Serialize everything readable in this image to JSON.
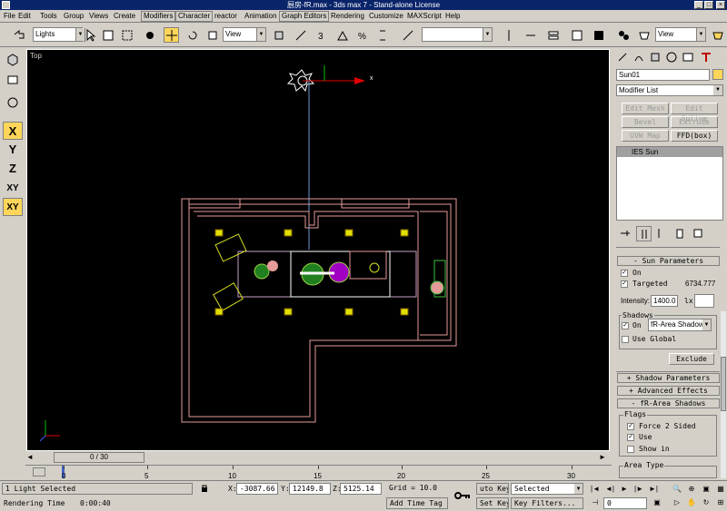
{
  "window": {
    "title": "厨房-fR.max - 3ds max 7 - Stand-alone License"
  },
  "menu": [
    "File",
    "Edit",
    "Tools",
    "Group",
    "Views",
    "Create",
    "Modifiers",
    "Character",
    "reactor",
    "Animation",
    "Graph Editors",
    "Rendering",
    "Customize",
    "MAXScript",
    "Help"
  ],
  "toolbar": {
    "selection_filter": "Lights",
    "ref_coord": "View",
    "named_sel": "",
    "render_view": "View"
  },
  "left_toolbar": {
    "x": "X",
    "y": "Y",
    "z": "Z",
    "xy": "XY",
    "xy2": "XY"
  },
  "viewport": {
    "label": "Top",
    "axis_x": "x"
  },
  "command_panel": {
    "object_name": "Sun01",
    "modifier_list": "Modifier List",
    "mod_buttons": [
      "Edit Mesh",
      "Edit Spline",
      "Bevel",
      "Extrude",
      "UVW Map",
      "FFD(box)"
    ],
    "stack_item": "IES Sun",
    "sun_rollout": "Sun Parameters",
    "on_label": "On",
    "targeted_label": "Targeted",
    "targeted_value": "6734.777",
    "intensity_label": "Intensity:",
    "intensity_value": "1400.0",
    "lx_label": "lx",
    "shadows_label": "Shadows",
    "shadows_on_label": "On",
    "shadow_type": "fR-Area Shadow",
    "use_global": "Use Global",
    "exclude": "Exclude",
    "shadow_params": "Shadow Parameters",
    "advanced_effects": "Advanced Effects",
    "area_shadows": "fR-Area Shadows",
    "flags_label": "Flags",
    "force2sided": "Force 2 Sided",
    "use": "Use",
    "showin": "Show in",
    "area_type": "Area Type"
  },
  "timeline": {
    "slider": "0 / 30",
    "ticks": [
      "0",
      "5",
      "10",
      "15",
      "20",
      "25",
      "30"
    ]
  },
  "status": {
    "light_selected": "1 Light Selected",
    "rendering_time_label": "Rendering Time",
    "rendering_time": "0:00:40",
    "x_label": "X:",
    "x_value": "-3087.66",
    "y_label": "Y:",
    "y_value": "12149.8",
    "z_label": "Z:",
    "z_value": "5125.14",
    "grid": "Grid = 10.0",
    "add_time_tag": "Add Time Tag",
    "auto_key": "uto Key",
    "set_key": "Set Key",
    "selected": "Selected",
    "key_filters": "Key Filters...",
    "frame": "0"
  }
}
